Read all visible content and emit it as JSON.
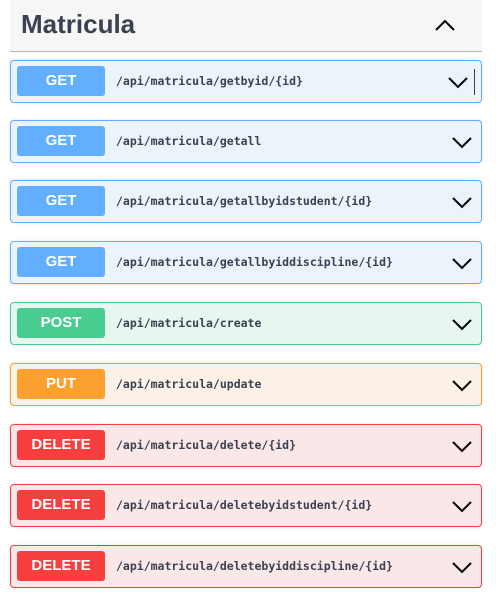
{
  "section": {
    "title": "Matricula"
  },
  "icons": {
    "collapse": "chevron-up-icon",
    "expand": "chevron-down-icon"
  },
  "colors": {
    "get": "#61affe",
    "post": "#49cc90",
    "put": "#fca130",
    "delete": "#f93e3e"
  },
  "operations": [
    {
      "method": "GET",
      "path": "/api/matricula/getbyid/{id}"
    },
    {
      "method": "GET",
      "path": "/api/matricula/getall"
    },
    {
      "method": "GET",
      "path": "/api/matricula/getallbyidstudent/{id}"
    },
    {
      "method": "GET",
      "path": "/api/matricula/getallbyiddiscipline/{id}"
    },
    {
      "method": "POST",
      "path": "/api/matricula/create"
    },
    {
      "method": "PUT",
      "path": "/api/matricula/update"
    },
    {
      "method": "DELETE",
      "path": "/api/matricula/delete/{id}"
    },
    {
      "method": "DELETE",
      "path": "/api/matricula/deletebyidstudent/{id}"
    },
    {
      "method": "DELETE",
      "path": "/api/matricula/deletebyiddiscipline/{id}"
    }
  ]
}
